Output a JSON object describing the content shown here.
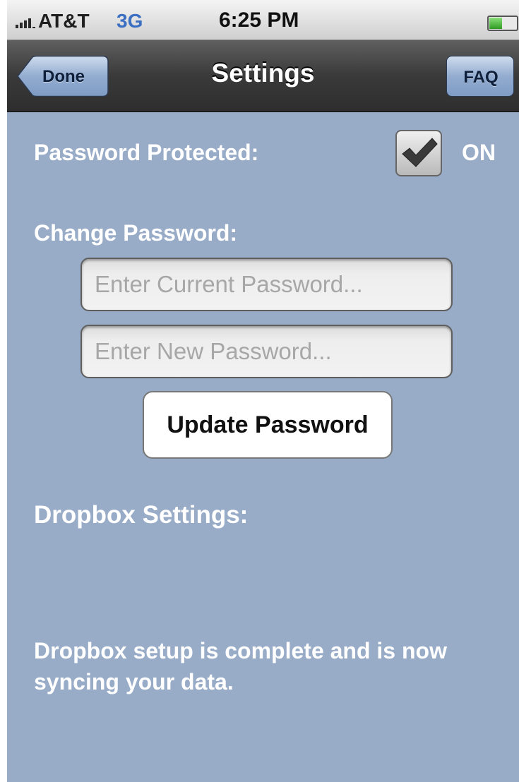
{
  "status_bar": {
    "carrier": "AT&T",
    "network": "3G",
    "time": "6:25 PM",
    "signal_icon": "signal-bars-icon",
    "battery_icon": "battery-icon",
    "battery_level": 0.45
  },
  "nav_bar": {
    "title": "Settings",
    "back_label": "Done",
    "faq_label": "FAQ"
  },
  "settings": {
    "password_protected_label": "Password Protected:",
    "password_protected_checked": true,
    "password_protected_state": "ON",
    "change_password_label": "Change Password:",
    "current_password_placeholder": "Enter Current Password...",
    "new_password_placeholder": "Enter New Password...",
    "update_button_label": "Update Password",
    "dropbox_heading": "Dropbox Settings:",
    "dropbox_status": "Dropbox setup is complete and is now syncing your data."
  },
  "colors": {
    "background": "#98acc8",
    "nav_bar": "#3a3a3a",
    "network_text": "#3a6fc2"
  }
}
